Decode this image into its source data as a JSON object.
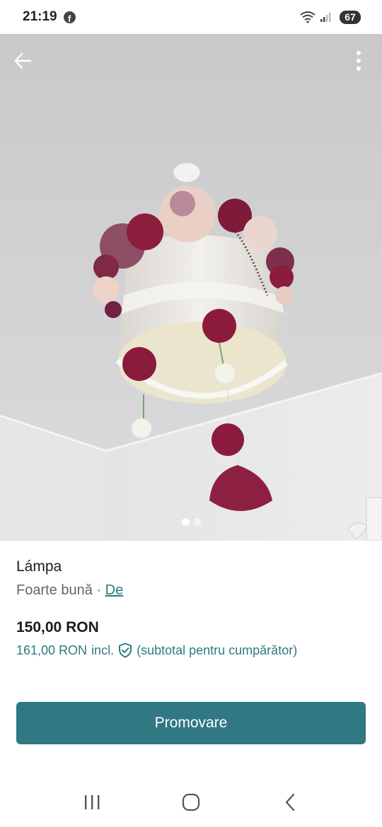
{
  "status_bar": {
    "time": "21:19",
    "facebook_glyph": "f",
    "battery": "67"
  },
  "gallery": {
    "image_count": 2,
    "active_index": 0
  },
  "item": {
    "title": "Lámpa",
    "condition": "Foarte bună",
    "separator": " · ",
    "brand_link": "De",
    "price": "150,00 RON",
    "total_price": "161,00 RON",
    "total_incl": "incl.",
    "total_note": "(subtotal pentru cumpărător)"
  },
  "actions": {
    "promote_label": "Promovare"
  },
  "colors": {
    "accent": "#307882",
    "link": "#2f7a7e"
  },
  "icons": {
    "back": "arrow-left-icon",
    "more": "more-vertical-icon",
    "shield": "shield-check-icon",
    "nav_recent": "recent-apps-icon",
    "nav_home": "home-icon",
    "nav_back": "chevron-left-icon"
  }
}
